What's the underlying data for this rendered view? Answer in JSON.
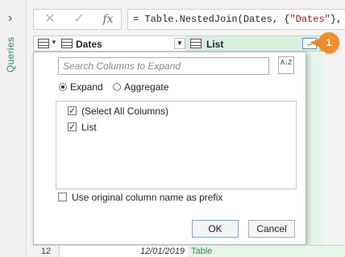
{
  "rail": {
    "label": "Queries"
  },
  "formula_bar": {
    "cancel_glyph": "✕",
    "commit_glyph": "✓",
    "fx_label": "fx",
    "formula_prefix": "= Table.NestedJoin(Dates, {",
    "formula_string": "\"Dates\"",
    "formula_suffix": "}, Li"
  },
  "table_header": {
    "col1_label": "Dates",
    "col2_label": "List",
    "expand_glyph": "↔"
  },
  "callout": {
    "number": "1",
    "color": "#f28c28"
  },
  "dialog": {
    "search_placeholder": "Search Columns to Expand",
    "sort_glyph": "A↓Z",
    "options": [
      {
        "label": "Expand",
        "selected": true
      },
      {
        "label": "Aggregate",
        "selected": false
      }
    ],
    "columns": [
      {
        "label": "(Select All Columns)",
        "checked": true
      },
      {
        "label": "List",
        "checked": true
      }
    ],
    "prefix_label": "Use original column name as prefix",
    "prefix_checked": false,
    "ok_label": "OK",
    "cancel_label": "Cancel"
  },
  "row": {
    "number": "12",
    "date": "12/01/2019",
    "list_value": "Table"
  },
  "colors": {
    "list_column": "#d9f0dd",
    "accent_green": "#2e8b57"
  }
}
